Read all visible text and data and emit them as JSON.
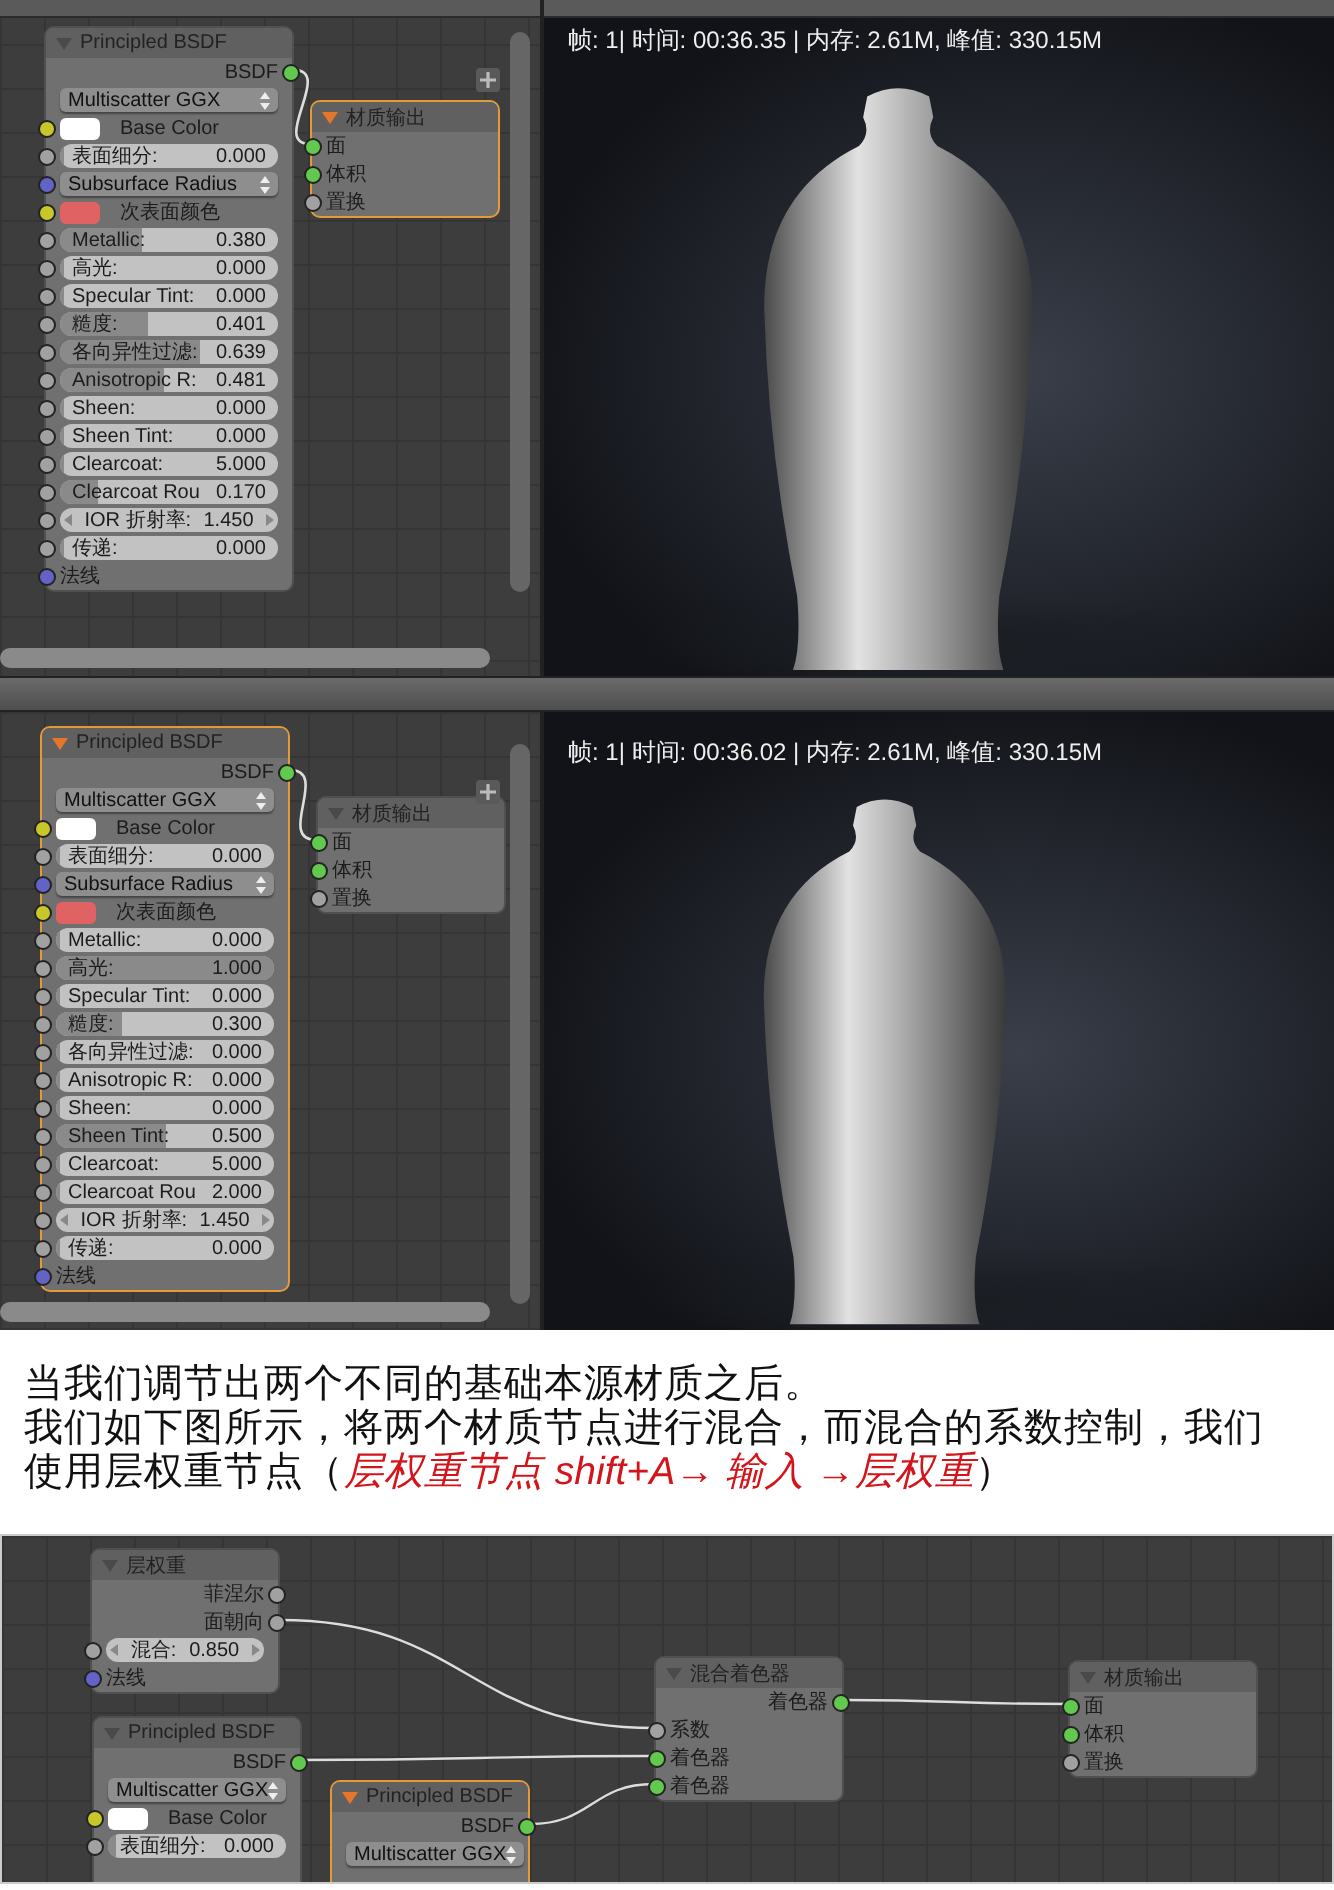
{
  "editor_shots": [
    {
      "nodes": [
        {
          "title": "Principled BSDF",
          "selected": false,
          "rows": [
            {
              "kind": "output",
              "label": "BSDF",
              "color": "#62c94e"
            },
            {
              "kind": "dropdown",
              "label": "Multiscatter GGX"
            },
            {
              "kind": "color",
              "label": "Base Color",
              "color": "#ffffff"
            },
            {
              "kind": "slider",
              "label": "表面细分:",
              "value": "0.000",
              "level": 0,
              "color": "#a1a1a1"
            },
            {
              "kind": "dropdown",
              "label": "Subsurface Radius",
              "color": "#6363c7"
            },
            {
              "kind": "color",
              "label": "次表面颜色",
              "color": "#e06262"
            },
            {
              "kind": "slider",
              "label": "Metallic:",
              "value": "0.380",
              "level": 0.38,
              "color": "#a1a1a1"
            },
            {
              "kind": "slider",
              "label": "高光:",
              "value": "0.000",
              "level": 0,
              "color": "#a1a1a1"
            },
            {
              "kind": "slider",
              "label": "Specular Tint:",
              "value": "0.000",
              "level": 0,
              "color": "#a1a1a1"
            },
            {
              "kind": "slider",
              "label": "糙度:",
              "value": "0.401",
              "level": 0.401,
              "color": "#a1a1a1"
            },
            {
              "kind": "slider",
              "label": "各向异性过滤:",
              "value": "0.639",
              "level": 0.639,
              "color": "#a1a1a1"
            },
            {
              "kind": "slider",
              "label": "Anisotropic R:",
              "value": "0.481",
              "level": 0.481,
              "color": "#a1a1a1"
            },
            {
              "kind": "slider",
              "label": "Sheen:",
              "value": "0.000",
              "level": 0,
              "color": "#a1a1a1"
            },
            {
              "kind": "slider",
              "label": "Sheen Tint:",
              "value": "0.000",
              "level": 0,
              "color": "#a1a1a1"
            },
            {
              "kind": "slider",
              "label": "Clearcoat:",
              "value": "5.000",
              "level": 0,
              "color": "#a1a1a1"
            },
            {
              "kind": "slider",
              "label": "Clearcoat Rou",
              "value": "0.170",
              "level": 0.17,
              "color": "#a1a1a1"
            },
            {
              "kind": "number",
              "label": "IOR 折射率:",
              "value": "1.450",
              "color": "#a1a1a1"
            },
            {
              "kind": "slider",
              "label": "传递:",
              "value": "0.000",
              "level": 0,
              "color": "#a1a1a1"
            },
            {
              "kind": "input",
              "label": "法线",
              "color": "#6363c7"
            }
          ]
        },
        {
          "title": "材质输出",
          "selected": true,
          "rows": [
            {
              "kind": "input",
              "label": "面",
              "color": "#62c94e"
            },
            {
              "kind": "input",
              "label": "体积",
              "color": "#62c94e"
            },
            {
              "kind": "input",
              "label": "置换",
              "color": "#a1a1a1"
            }
          ]
        }
      ],
      "render": {
        "stats": "帧: 1| 时间: 00:36.35 | 内存: 2.61M, 峰值: 330.15M"
      }
    },
    {
      "nodes": [
        {
          "title": "Principled BSDF",
          "selected": true,
          "rows": [
            {
              "kind": "output",
              "label": "BSDF",
              "color": "#62c94e"
            },
            {
              "kind": "dropdown",
              "label": "Multiscatter GGX"
            },
            {
              "kind": "color",
              "label": "Base Color",
              "color": "#ffffff"
            },
            {
              "kind": "slider",
              "label": "表面细分:",
              "value": "0.000",
              "level": 0,
              "color": "#a1a1a1"
            },
            {
              "kind": "dropdown",
              "label": "Subsurface Radius",
              "color": "#6363c7"
            },
            {
              "kind": "color",
              "label": "次表面颜色",
              "color": "#e06262"
            },
            {
              "kind": "slider",
              "label": "Metallic:",
              "value": "0.000",
              "level": 0,
              "color": "#a1a1a1"
            },
            {
              "kind": "slider",
              "label": "高光:",
              "value": "1.000",
              "level": 1,
              "color": "#a1a1a1"
            },
            {
              "kind": "slider",
              "label": "Specular Tint:",
              "value": "0.000",
              "level": 0,
              "color": "#a1a1a1"
            },
            {
              "kind": "slider",
              "label": "糙度:",
              "value": "0.300",
              "level": 0.3,
              "color": "#a1a1a1"
            },
            {
              "kind": "slider",
              "label": "各向异性过滤:",
              "value": "0.000",
              "level": 0,
              "color": "#a1a1a1"
            },
            {
              "kind": "slider",
              "label": "Anisotropic R:",
              "value": "0.000",
              "level": 0,
              "color": "#a1a1a1"
            },
            {
              "kind": "slider",
              "label": "Sheen:",
              "value": "0.000",
              "level": 0,
              "color": "#a1a1a1"
            },
            {
              "kind": "slider",
              "label": "Sheen Tint:",
              "value": "0.500",
              "level": 0.5,
              "color": "#a1a1a1"
            },
            {
              "kind": "slider",
              "label": "Clearcoat:",
              "value": "5.000",
              "level": 0,
              "color": "#a1a1a1"
            },
            {
              "kind": "slider",
              "label": "Clearcoat Rou",
              "value": "2.000",
              "level": 0,
              "color": "#a1a1a1"
            },
            {
              "kind": "number",
              "label": "IOR 折射率:",
              "value": "1.450",
              "color": "#a1a1a1"
            },
            {
              "kind": "slider",
              "label": "传递:",
              "value": "0.000",
              "level": 0,
              "color": "#a1a1a1"
            },
            {
              "kind": "input",
              "label": "法线",
              "color": "#6363c7"
            }
          ]
        },
        {
          "title": "材质输出",
          "selected": false,
          "rows": [
            {
              "kind": "input",
              "label": "面",
              "color": "#62c94e"
            },
            {
              "kind": "input",
              "label": "体积",
              "color": "#62c94e"
            },
            {
              "kind": "input",
              "label": "置换",
              "color": "#a1a1a1"
            }
          ]
        }
      ],
      "render": {
        "stats": "帧: 1| 时间: 00:36.02 | 内存: 2.61M, 峰值: 330.15M"
      }
    }
  ],
  "paragraph": {
    "first_sentence": "当我们调节出两个不同的基础本源材质之后。",
    "second_sentence": "我们如下图所示，将两个材质节点进行混合，而混合的系数控制，我们使用层权重节点（",
    "highlight": "层权重节点 shift+A→ 输入 →层权重",
    "closing": "）"
  },
  "mix_editor": {
    "nodes": [
      {
        "title": "层权重",
        "selected": false,
        "rows": [
          {
            "kind": "output",
            "label": "菲涅尔",
            "color": "#a1a1a1"
          },
          {
            "kind": "output",
            "label": "面朝向",
            "color": "#a1a1a1"
          },
          {
            "kind": "number",
            "label": "混合:",
            "value": "0.850",
            "color": "#a1a1a1"
          },
          {
            "kind": "input",
            "label": "法线",
            "color": "#6363c7"
          }
        ]
      },
      {
        "title": "Principled BSDF",
        "selected": false,
        "rows": [
          {
            "kind": "output",
            "label": "BSDF",
            "color": "#62c94e"
          },
          {
            "kind": "dropdown",
            "label": "Multiscatter GGX"
          },
          {
            "kind": "color",
            "label": "Base Color",
            "color": "#ffffff"
          },
          {
            "kind": "slider",
            "label": "表面细分:",
            "value": "0.000",
            "level": 0.05,
            "color": "#a1a1a1"
          }
        ]
      },
      {
        "title": "Principled BSDF",
        "selected": true,
        "rows": [
          {
            "kind": "output",
            "label": "BSDF",
            "color": "#62c94e"
          },
          {
            "kind": "dropdown",
            "label": "Multiscatter GGX"
          }
        ]
      },
      {
        "title": "混合着色器",
        "selected": false,
        "rows": [
          {
            "kind": "output",
            "label": "着色器",
            "color": "#62c94e"
          },
          {
            "kind": "input",
            "label": "系数",
            "color": "#a1a1a1"
          },
          {
            "kind": "input",
            "label": "着色器",
            "color": "#62c94e"
          },
          {
            "kind": "input",
            "label": "着色器",
            "color": "#62c94e"
          }
        ]
      },
      {
        "title": "材质输出",
        "selected": false,
        "rows": [
          {
            "kind": "input",
            "label": "面",
            "color": "#62c94e"
          },
          {
            "kind": "input",
            "label": "体积",
            "color": "#62c94e"
          },
          {
            "kind": "input",
            "label": "置换",
            "color": "#a1a1a1"
          }
        ]
      }
    ]
  }
}
